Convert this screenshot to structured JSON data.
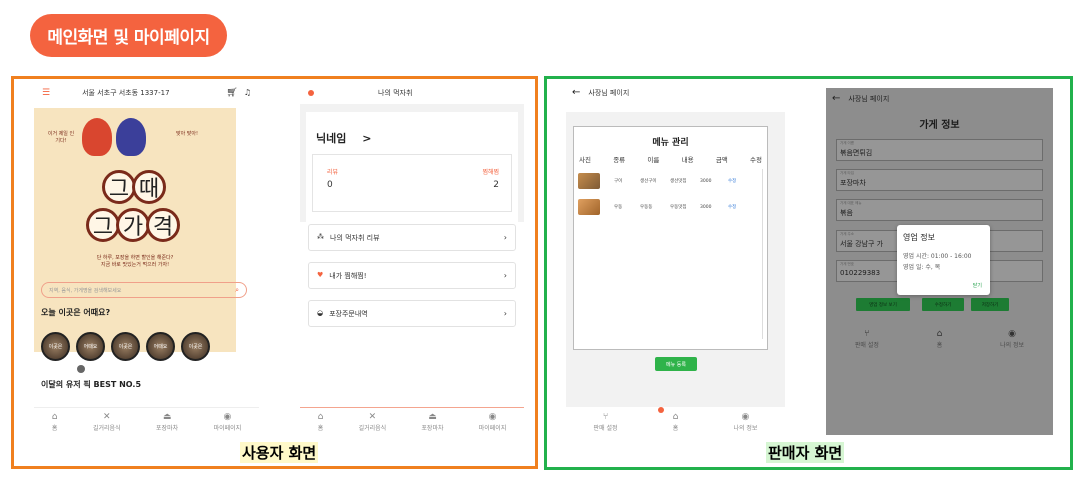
{
  "header": {
    "title": "메인화면 및 마이페이지"
  },
  "captions": {
    "user": "사용자 화면",
    "seller": "판매자 화면"
  },
  "home": {
    "address": "서울 서초구 서초동 1337-17",
    "icons": [
      "menu-icon",
      "cart-icon",
      "bell-icon"
    ],
    "poster": {
      "speech_left": "이거 제일 인기다!",
      "speech_right": "맞아 맞아!",
      "line1": [
        "그",
        "때"
      ],
      "line2": [
        "그",
        "가",
        "격"
      ],
      "tagline1": "단 하루, 포장을 하면 할인을 해준다?",
      "tagline2": "지금 바로 맛있는거 먹으러 가자!"
    },
    "search_placeholder": "지역, 음식, 가게명을 검색해보세요",
    "section_today": "오늘 이곳은 어때요?",
    "thumb_labels": [
      "이곳은",
      "어때요",
      "이곳은",
      "어때요",
      "이곳은"
    ],
    "section_best": "이달의 유저 픽 BEST NO.5"
  },
  "tabs": {
    "home": "홈",
    "street": "길거리음식",
    "takeout": "포장마차",
    "mypage": "마이페이지"
  },
  "mypage": {
    "title": "나의 먹자취",
    "nickname": "닉네임",
    "nickname_arrow": ">",
    "review_label": "리뷰",
    "review_count": "0",
    "likes_label": "찜해찜",
    "likes_count": "2",
    "menu": [
      {
        "label": "나의 먹자취 리뷰",
        "icon": "footprint-icon"
      },
      {
        "label": "내가 찜해찜!",
        "icon": "heart-icon"
      },
      {
        "label": "포장주문내역",
        "icon": "bowl-icon"
      }
    ]
  },
  "seller": {
    "back": "←",
    "title": "사장님 페이지",
    "menu_title": "메뉴 관리",
    "columns": [
      "사진",
      "종류",
      "이름",
      "내용",
      "금액",
      "수정"
    ],
    "rows": [
      {
        "type": "구이",
        "name": "생선구이",
        "desc": "생선맛집",
        "price": "3000",
        "edit": "수정"
      },
      {
        "type": "우동",
        "name": "우동동",
        "desc": "우동맛집",
        "price": "3000",
        "edit": "수정"
      }
    ],
    "register_button": "메뉴 등록",
    "bottom_tabs": [
      "판매 설정",
      "홈",
      "나의 정보"
    ]
  },
  "store": {
    "back": "←",
    "title": "사장님 페이지",
    "heading": "가게 정보",
    "fields": [
      {
        "label": "가게 이름",
        "value": "볶음면튀김"
      },
      {
        "label": "가게 타입",
        "value": "포장마차"
      },
      {
        "label": "가게 대표 메뉴",
        "value": "볶음"
      },
      {
        "label": "가게 주소",
        "value": "서울 강남구 가"
      },
      {
        "label": "가게 번호",
        "value": "010229383"
      }
    ],
    "buttons": [
      "영업 정보 보기",
      "수정하기",
      "저장하기"
    ],
    "modal": {
      "title": "영업 정보",
      "hours": "영업 시간: 01:00 - 16:00",
      "days": "영업 일: 수, 목",
      "close": "닫기"
    },
    "bottom_tabs": [
      "판매 설정",
      "홈",
      "나의 정보"
    ]
  },
  "colors": {
    "accent": "#f4633f",
    "user_frame": "#f0801f",
    "seller_frame": "#22b14c",
    "heart": "#f4633f"
  }
}
